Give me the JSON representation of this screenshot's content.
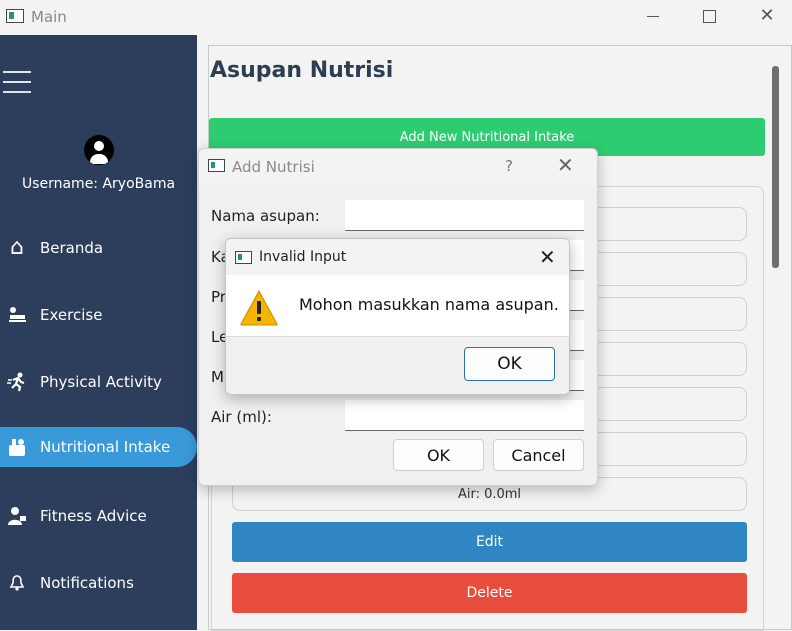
{
  "window": {
    "title": "Main",
    "close_glyph": "✕"
  },
  "sidebar": {
    "username": "Username: AryoBama",
    "items": [
      {
        "label": "Beranda",
        "icon": "home-icon",
        "glyph": "⌂"
      },
      {
        "label": "Exercise",
        "icon": "exercise-icon",
        "glyph": "🛏"
      },
      {
        "label": "Physical Activity",
        "icon": "running-icon",
        "glyph": "🏃"
      },
      {
        "label": "Nutritional Intake",
        "icon": "nutrition-icon",
        "glyph": "🍴",
        "active": true
      },
      {
        "label": "Fitness Advice",
        "icon": "advice-icon",
        "glyph": "👤"
      },
      {
        "label": "Notifications",
        "icon": "bell-icon",
        "glyph": "🔔"
      }
    ]
  },
  "main": {
    "title": "Asupan Nutrisi",
    "add_button": "Add New Nutritional Intake",
    "card": {
      "air_label": "Air: 0.0ml",
      "edit_button": "Edit",
      "delete_button": "Delete"
    }
  },
  "dialog": {
    "title": "Add Nutrisi",
    "help": "?",
    "close": "✕",
    "fields": {
      "nama_label": "Nama asupan:",
      "kalori_label": "Ka",
      "protein_label": "Pr",
      "lemak_label": "Le",
      "m_label": "M",
      "air_label": "Air (ml):"
    },
    "ok_button": "OK",
    "cancel_button": "Cancel"
  },
  "messagebox": {
    "title": "Invalid Input",
    "close": "✕",
    "message": "Mohon masukkan nama asupan.",
    "ok_button": "OK"
  },
  "colors": {
    "sidebar_bg": "#2c3e5c",
    "active_item": "#3a9ad9",
    "add_button": "#2ecc71",
    "edit_button": "#2f86c3",
    "delete_button": "#e74c3c",
    "warning": "#f5b400"
  }
}
